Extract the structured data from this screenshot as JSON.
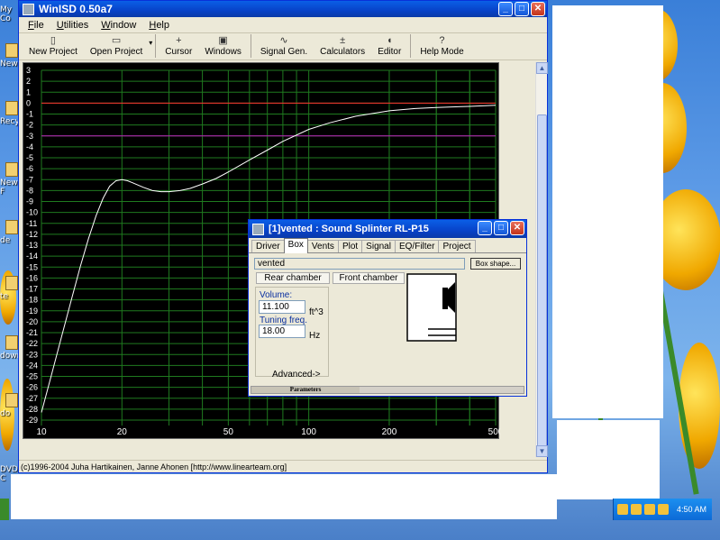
{
  "desktop": {
    "icons": [
      "My Co",
      "New",
      "Recy",
      "New F",
      "de",
      "te",
      "down",
      "do",
      "DVD C"
    ],
    "taskbar_clock": "4:50 AM"
  },
  "main_window": {
    "title": "WinISD 0.50a7",
    "menu": [
      "File",
      "Utilities",
      "Window",
      "Help"
    ],
    "toolbar": [
      {
        "label": "New Project",
        "icon": "new-project-icon"
      },
      {
        "label": "Open Project",
        "icon": "open-folder-icon"
      },
      {
        "label": "Cursor",
        "icon": "cursor-icon"
      },
      {
        "label": "Windows",
        "icon": "windows-icon"
      },
      {
        "label": "Signal Gen.",
        "icon": "sine-wave-icon"
      },
      {
        "label": "Calculators",
        "icon": "calculator-icon"
      },
      {
        "label": "Editor",
        "icon": "speaker-icon"
      },
      {
        "label": "Help Mode",
        "icon": "help-icon"
      }
    ],
    "status": "(c)1996-2004 Juha Hartikainen, Janne Ahonen [http://www.linearteam.org]"
  },
  "chart_data": {
    "type": "line",
    "xscale": "log",
    "xlim": [
      10,
      500
    ],
    "ylim": [
      -29,
      3
    ],
    "x_tick_labels": [
      "10",
      "20",
      "50",
      "100",
      "200",
      "500"
    ],
    "y_tick_labels": [
      "3",
      "2",
      "1",
      "0",
      "-1",
      "-2",
      "-3",
      "-4",
      "-5",
      "-6",
      "-7",
      "-8",
      "-9",
      "-10",
      "-11",
      "-12",
      "-13",
      "-14",
      "-15",
      "-16",
      "-17",
      "-18",
      "-19",
      "-20",
      "-21",
      "-22",
      "-23",
      "-24",
      "-25",
      "-26",
      "-27",
      "-28",
      "-29"
    ],
    "grid": true,
    "series": [
      {
        "x": [
          10,
          11,
          12,
          13,
          14,
          15,
          16,
          17,
          18,
          19,
          20,
          21,
          22,
          24,
          26,
          28,
          30,
          33,
          36,
          40,
          45,
          50,
          60,
          70,
          80,
          100,
          120,
          150,
          200,
          250,
          300,
          400,
          500
        ],
        "y": [
          -28.3,
          -24.5,
          -21.0,
          -17.8,
          -14.9,
          -12.4,
          -10.3,
          -8.7,
          -7.6,
          -7.1,
          -7.0,
          -7.1,
          -7.3,
          -7.7,
          -8.0,
          -8.1,
          -8.1,
          -8.0,
          -7.8,
          -7.4,
          -6.9,
          -6.3,
          -5.2,
          -4.3,
          -3.5,
          -2.4,
          -1.8,
          -1.2,
          -0.7,
          -0.5,
          -0.4,
          -0.3,
          -0.2
        ],
        "color": "#ffffff"
      }
    ],
    "reference_lines": [
      {
        "y": 0,
        "color": "#ff3030"
      },
      {
        "y": -3,
        "color": "#c020c0"
      }
    ]
  },
  "sub_window": {
    "title": "[1]vented : Sound Splinter RL-P15",
    "tabs": [
      "Driver",
      "Box",
      "Vents",
      "Plot",
      "Signal",
      "EQ/Filter",
      "Project"
    ],
    "active_tab": "Box",
    "box_type": "vented",
    "box_shape_button": "Box shape...",
    "rear_chamber": "Rear chamber",
    "front_chamber": "Front chamber",
    "volume_label": "Volume:",
    "volume_value": "11.100",
    "volume_unit": "ft^3",
    "tuning_label": "Tuning freq.",
    "tuning_value": "18.00",
    "tuning_unit": "Hz",
    "advanced": "Advanced->",
    "status_segment": "Parameters"
  }
}
